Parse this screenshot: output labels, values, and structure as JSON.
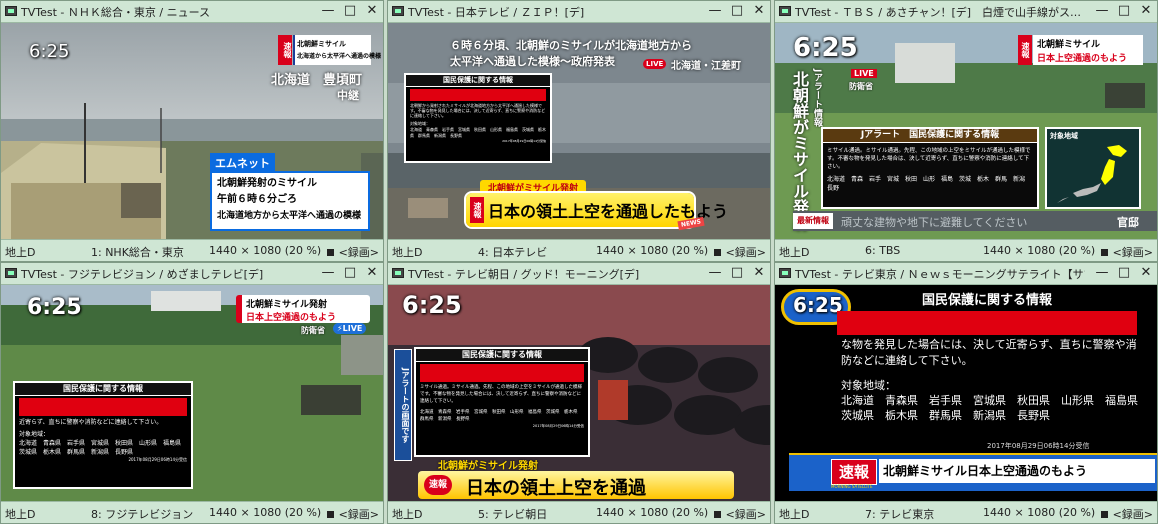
{
  "windows": [
    {
      "title": "TVTest - ＮＨＫ総合・東京 / ニュース",
      "clock": "6:25",
      "status": {
        "source": "地上D",
        "channel": "1: NHK総合・東京",
        "resolution": "1440 × 1080 (20 %)",
        "record": "<録画>"
      },
      "badge": "速報",
      "headline_lines": [
        "北朝鮮ミサイル",
        "北海道から太平洋へ通過の模様"
      ],
      "location": "北海道　豊頃町",
      "location_sub": "中継",
      "tag": "エムネット",
      "message_lines": [
        "北朝鮮発射のミサイル",
        "午前６時６分ごろ",
        "北海道地方から太平洋へ通過の模様"
      ]
    },
    {
      "title": "TVTest - 日本テレビ / ＺＩＰ！[デ]",
      "status": {
        "source": "地上D",
        "channel": "4: 日本テレビ",
        "resolution": "1440 × 1080 (20 %)",
        "record": "<録画>"
      },
      "top_caption": [
        "６時６分頃、北朝鮮のミサイルが北海道地方から",
        "太平洋へ通過した模様～政府発表"
      ],
      "live": "LIVE",
      "location": "北海道・江差町",
      "panel_title": "国民保護に関する情報",
      "panel_text": "北朝鮮から発射されたミサイルが北海道地方から太平洋へ通過した模様です。不審な物を発見した場合には、決して近寄らず、直ちに警察や消防などに連絡して下さい。",
      "panel_region_label": "対象地域：",
      "panel_regions": "北海道　青森県　岩手県　宮城県　秋田県　山形県　福島県　茨城県　栃木県　群馬県　新潟県　長野県",
      "panel_time": "2017年08月29日06時14分受信",
      "sub_banner": "北朝鮮がミサイル発射",
      "badge": "速報",
      "main_banner": "日本の領土上空を通過したもよう",
      "news_tag": "NEWS"
    },
    {
      "title": "TVTest - ＴＢＳ / あさチャン！[デ]　白煙で山手線がス…",
      "clock": "6:25",
      "status": {
        "source": "地上D",
        "channel": "6: TBS",
        "resolution": "1440 × 1080 (20 %)",
        "record": "<録画>"
      },
      "badge": "速報",
      "headline_lines": [
        "北朝鮮ミサイル",
        "日本上空通過のもよう"
      ],
      "live": "LIVE",
      "live_sub": "防衛省",
      "vertical_small": "Jアラート情報",
      "vertical_big": "北朝鮮がミサイル発射",
      "panel_title": "Jアラート　国民保護に関する情報",
      "panel_text": "ミサイル通過。ミサイル通過。先程、この地域の上空をミサイルが通過した模様です。不審な物を発見した場合は、決して近寄らず、直ちに警察や消防に連絡して下さい。",
      "panel_regions": "北海道　青森　岩手　宮城　秋田　山形　福島　茨城　栃木　群馬　新潟　長野",
      "map_label": "対象地域",
      "ticker_tag": "最新情報",
      "ticker_text": "頑丈な建物や地下に避難してください",
      "ticker_right": "官邸"
    },
    {
      "title": "TVTest - フジテレビジョン / めざましテレビ[デ]",
      "clock": "6:25",
      "status": {
        "source": "地上D",
        "channel": "8: フジテレビジョン",
        "resolution": "1440 × 1080 (20 %)",
        "record": "<録画>"
      },
      "headline_lines": [
        "北朝鮮ミサイル発射",
        "日本上空通過のもよう"
      ],
      "live_sub": "防衛省",
      "live": "LIVE",
      "panel_title": "国民保護に関する情報",
      "panel_text": "近寄らず、直ちに警察や消防などに連絡して下さい。",
      "panel_region_label": "対象地域：",
      "panel_regions": "北海道　青森県　岩手県　宮城県　秋田県　山形県　福島県　茨城県　栃木県　群馬県　新潟県　長野県",
      "panel_time": "2017年08月29日06時14分受信"
    },
    {
      "title": "TVTest - テレビ朝日 / グッド！モーニング[デ]",
      "clock": "6:25",
      "status": {
        "source": "地上D",
        "channel": "5: テレビ朝日",
        "resolution": "1440 × 1080 (20 %)",
        "record": "<録画>"
      },
      "vertical_label": "Jアラートの画面です",
      "panel_title": "国民保護に関する情報",
      "panel_text": "ミサイル通過。ミサイル通過。先程、この地域の上空をミサイルが通過した模様です。不審な物を発見した場合には、決して近寄らず、直ちに警察や消防などに連絡して下さい。",
      "panel_regions": "北海道　青森県　岩手県　宮城県　秋田県　山形県　福島県　茨城県　栃木県　群馬県　新潟県　長野県",
      "panel_time": "2017年08月29日06時14分受信",
      "sub_banner": "北朝鮮がミサイル発射",
      "badge": "速報",
      "main_banner": "日本の領土上空を通過"
    },
    {
      "title": "TVTest - テレビ東京 / Ｎｅｗｓモーニングサテライト【サマ…",
      "clock": "6:25",
      "status": {
        "source": "地上D",
        "channel": "7: テレビ東京",
        "resolution": "1440 × 1080 (20 %)",
        "record": "<録画>"
      },
      "panel_title": "国民保護に関する情報",
      "panel_text": "な物を発見した場合には、決して近寄らず、直ちに警察や消防などに連絡して下さい。",
      "panel_region_label": "対象地域：",
      "panel_regions": "北海道　青森県　岩手県　宮城県　秋田県　山形県　福島県　茨城県　栃木県　群馬県　新潟県　長野県",
      "panel_time": "2017年08月29日06時14分受信",
      "badge": "速報",
      "banner": "北朝鮮ミサイル日本上空通過のもよう",
      "banner_sub": "MORNING SATELLITE"
    }
  ],
  "icons": {
    "minimize": "minimize-icon",
    "maximize": "maximize-icon",
    "close": "close-icon",
    "app": "tvtest-app-icon"
  },
  "colors": {
    "window_frame": "#cfe6d4",
    "alert_red": "#e00010",
    "badge_red": "#d9001b"
  }
}
